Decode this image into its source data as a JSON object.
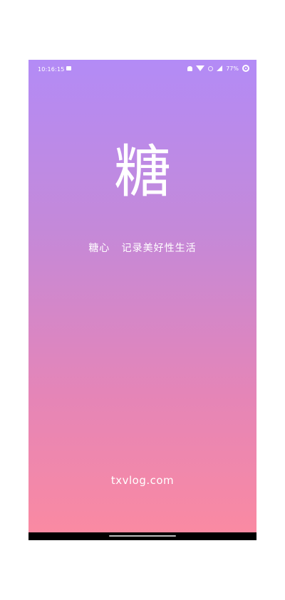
{
  "status_bar": {
    "time": "10:16:15",
    "battery_percent": "77%",
    "icons": [
      "image-icon",
      "bell-icon",
      "wifi-icon",
      "no-sim-icon",
      "signal-icon",
      "battery-icon"
    ]
  },
  "splash": {
    "logo_char": "糖",
    "slogan": "糖心   记录美好性生活",
    "website": "txvlog.com"
  },
  "colors": {
    "gradient_top": "#b38bf6",
    "gradient_bottom": "#fb8aa1",
    "text": "#ffffff"
  }
}
